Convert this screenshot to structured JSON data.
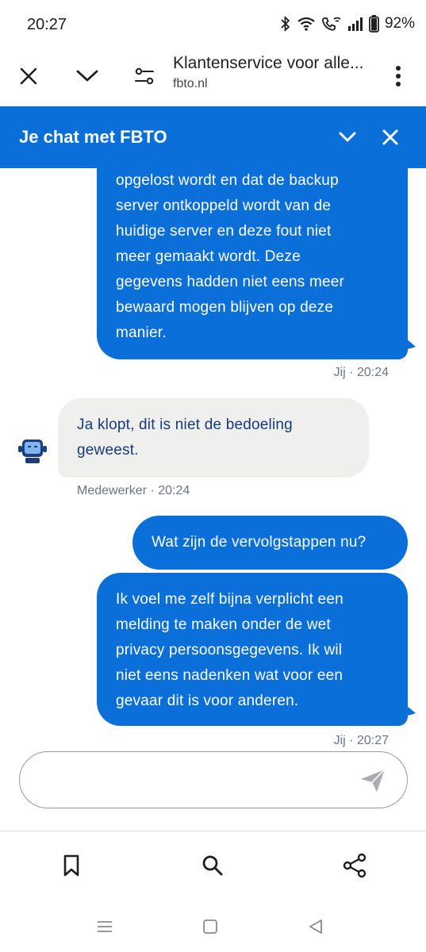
{
  "status_bar": {
    "time": "20:27",
    "battery": "92%",
    "icons": [
      "bluetooth-icon",
      "wifi-icon",
      "wifi-calling-icon",
      "signal-icon",
      "battery-icon"
    ]
  },
  "browser": {
    "title": "Klantenservice voor alle...",
    "url": "fbto.nl",
    "icons": [
      "close-icon",
      "chevron-down-icon",
      "site-settings-icon",
      "more-vert-icon"
    ]
  },
  "chat": {
    "header_title": "Je chat met FBTO",
    "accent_color": "#0a6fd8",
    "messages": [
      {
        "sender": "user",
        "text": "opgelost wordt en dat de backup\nserver ontkoppeld wordt van de\nhuidige server en deze fout niet\nmeer gemaakt wordt. Deze\ngegevens hadden niet eens meer\nbewaard mogen blijven op deze\nmanier."
      },
      {
        "meta": "Jij · 20:24"
      },
      {
        "sender": "agent",
        "text": "Ja klopt, dit is niet de bedoeling\ngeweest."
      },
      {
        "meta": "Medewerker · 20:24"
      },
      {
        "sender": "user",
        "text": "Wat zijn de vervolgstappen nu?"
      },
      {
        "sender": "user",
        "text": "Ik voel me zelf bijna verplicht een\nmelding te maken onder de wet\nprivacy persoonsgegevens. Ik wil\nniet eens nadenken wat voor een\ngevaar dit is voor anderen."
      },
      {
        "meta": "Jij · 20:27"
      }
    ],
    "input": {
      "value": "",
      "placeholder": ""
    }
  },
  "bottom_bar": {
    "icons": [
      "bookmark-icon",
      "search-icon",
      "share-icon"
    ]
  },
  "nav_bar": {
    "icons": [
      "recents-icon",
      "home-icon",
      "back-icon"
    ]
  }
}
